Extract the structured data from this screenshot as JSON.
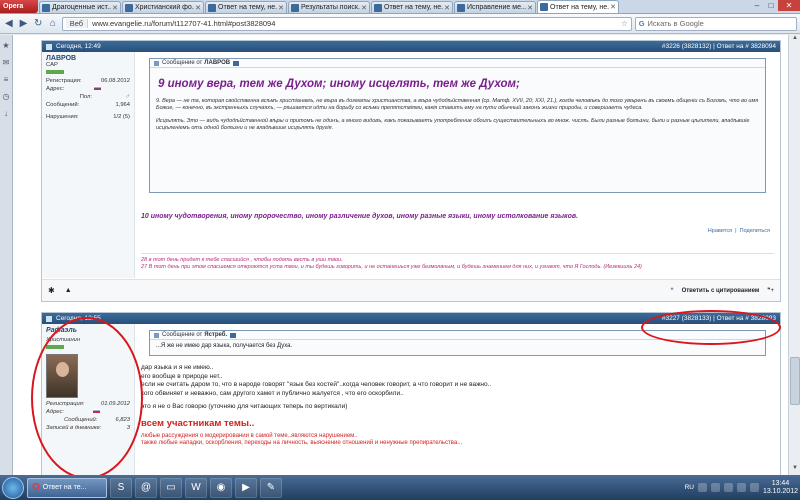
{
  "browser": {
    "opera_label": "Opera",
    "tabs": [
      {
        "title": "Драгоценные ист..."
      },
      {
        "title": "Христианский фо..."
      },
      {
        "title": "Ответ на тему, не..."
      },
      {
        "title": "Результаты поиск..."
      },
      {
        "title": "Ответ на тему, не..."
      },
      {
        "title": "Исправление ме..."
      },
      {
        "title": "Ответ на тему, не..."
      }
    ],
    "active_tab_index": 6,
    "web_label": "Веб",
    "url": "www.evangelie.ru/forum/t112707-41.html#post3828094",
    "search_placeholder": "Искать в Google",
    "win_min": "–",
    "win_max": "□",
    "win_close": "✕"
  },
  "post1": {
    "date": "Сегодня, 12:49",
    "number": "#3226 (3828132) | Ответ на # 3828094",
    "username": "ЛАВРОВ",
    "user_status": "CAP",
    "reg_label": "Регистрация:",
    "reg_value": "06.08.2012",
    "address_label": "Адрес:",
    "gender_label": "Пол:",
    "gender_value": "♂",
    "messages_label": "Сообщений:",
    "messages_value": "1,964",
    "violations_label": "Нарушения:",
    "violations_value": "1/2 (5)",
    "quote_label": "Сообщение от",
    "quote_author": "ЛАВРОВ",
    "quote_headline": "9 иному вера, тем же Духом; иному исцелять, тем же Духом;",
    "quote_p1": "9. Вера — не та, которая свойственна всѣмъ христіанамъ, не вѣра въ догматы христианства, а вѣра чудодѣйственная (ср. Матф. XVII, 20; XXI, 21.), когда человѣкъ до того увѣренъ въ своемъ общеніи съ Богомъ, что во имя Божие, — конечно, въ экстренныхъ случаяхъ, — рѣшается идти на борьбу со всѣми препятствіями, какія ставитъ ему на пути обычный законъ жизни природы, и совершаетъ чудеса.",
    "quote_p2": "Исцѣлять. Это — видъ чудодѣйственной вѣры и притомъ не одинъ, а много видовъ, какъ показываетъ употребление обоихъ существительныхъ во множ. числѣ. Были разные болѣзни, были и разные цѣлители, владѣвшіе исцѣленіемъ отъ одной болѣзни и не владѣвшие исцѣлять другія.",
    "purple_line": "10 иному чудотворения, иному пророчество, иному различение духов, иному разные языки, иному истолкование языков.",
    "like_label": "Нравится",
    "share_label": "Поделиться",
    "sig_line1": "28 в тот день придет к тебе спасшийся , чтобы подать весть в уши твои.",
    "sig_line2": "27 В тот день при этом спасшемся откроются уста твои, и ты будешь говорить, и не останешься уже безмолвным, и будешь знамением для них, и узнают, что Я Господь. (Иезекииль 24)",
    "reply_quote_label": "Ответить с цитированием"
  },
  "post2": {
    "date": "Сегодня, 12:55",
    "number": "#3227 (3828133) | Ответ на # 3828093",
    "username": "Рафаэль",
    "user_status": "Христианин",
    "reg_label": "Регистрация:",
    "reg_value": "01.09.2012",
    "address_label": "Адрес:",
    "messages_label": "Сообщений:",
    "messages_value": "6,823",
    "diary_label": "Записей в дневнике:",
    "diary_value": "3",
    "quote_label": "Сообщение от",
    "quote_author": "Ястреб.",
    "quote_text": "...Я же не имею дар языка, получается без Духа.",
    "line1": "дар языка и я не имею..",
    "line2": "его вообще в природе нет..",
    "line3": "если не считать даром то, что в народе говорят \"язык без костей\"..когда человек говорит, а что говорит и не важно..",
    "line4": "кого обвиняет и неважно, сам другого хамет и публично жалуется , что его оскорбили..",
    "line5": "это я не о Вас говорю (уточняю для читающих теперь по вертикали)",
    "red_heading": "всем участникам темы..",
    "red_line1": "любые рассуждения о модерировании в самой теме..являются нарушением..",
    "red_line2": "также любые нападки, оскорбления, переходы на личность, выяснение отношений и ненужные препирательства..."
  },
  "taskbar": {
    "active_label": "Ответ на те...",
    "lang": "RU",
    "clock_time": "13:44",
    "clock_date": "13.10.2012"
  },
  "icons": {
    "back": "back-arrow-icon",
    "forward": "forward-arrow-icon",
    "reload": "reload-icon",
    "home": "home-icon"
  },
  "colors": {
    "accent_purple": "#7a1e8c",
    "annotation_red": "#d9161b",
    "forum_header": "#27507b"
  }
}
